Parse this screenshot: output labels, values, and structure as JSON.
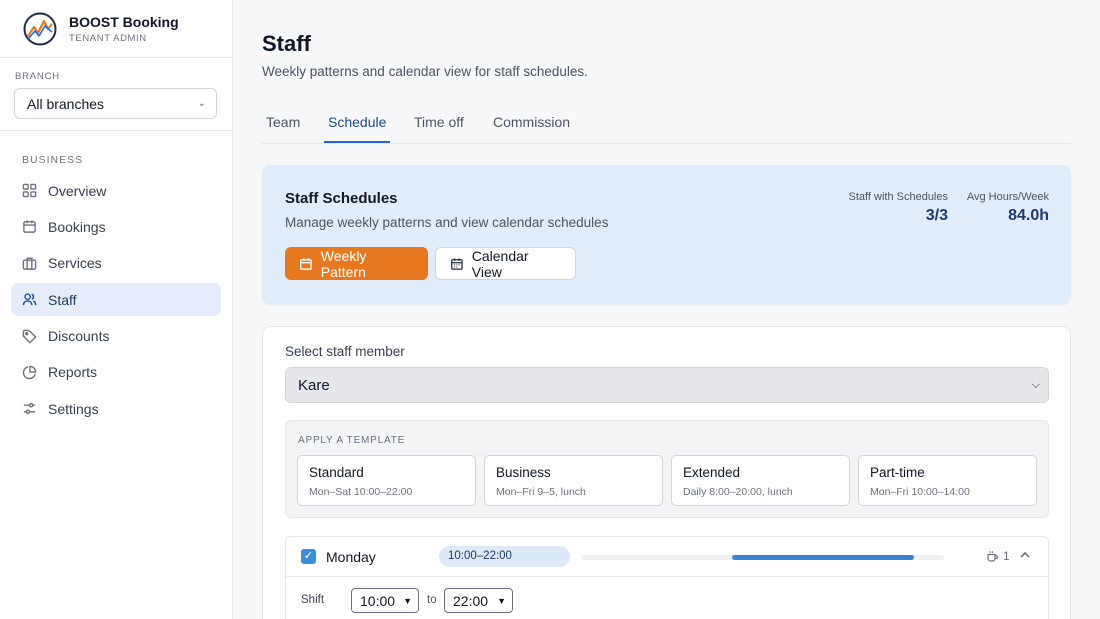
{
  "brand": {
    "name": "BOOST Booking",
    "role": "TENANT ADMIN"
  },
  "branch": {
    "label": "BRANCH",
    "selected": "All branches"
  },
  "sidebar": {
    "section": "BUSINESS",
    "items": [
      {
        "label": "Overview",
        "icon": "grid-icon"
      },
      {
        "label": "Bookings",
        "icon": "calendar-icon"
      },
      {
        "label": "Services",
        "icon": "briefcase-icon"
      },
      {
        "label": "Staff",
        "icon": "users-icon",
        "active": true
      },
      {
        "label": "Discounts",
        "icon": "tag-icon"
      },
      {
        "label": "Reports",
        "icon": "pie-chart-icon"
      },
      {
        "label": "Settings",
        "icon": "sliders-icon"
      }
    ]
  },
  "page": {
    "title": "Staff",
    "subtitle": "Weekly patterns and calendar view for staff schedules."
  },
  "tabs": [
    {
      "label": "Team"
    },
    {
      "label": "Schedule",
      "active": true
    },
    {
      "label": "Time off"
    },
    {
      "label": "Commission"
    }
  ],
  "hero": {
    "title": "Staff Schedules",
    "subtitle": "Manage weekly patterns and view calendar schedules",
    "stats": [
      {
        "label": "Staff with Schedules",
        "value": "3/3"
      },
      {
        "label": "Avg Hours/Week",
        "value": "84.0h"
      }
    ],
    "buttons": {
      "weekly": "Weekly Pattern",
      "calendar": "Calendar View"
    }
  },
  "editor": {
    "staff_label": "Select staff member",
    "staff_selected": "Kare",
    "template_label": "APPLY A TEMPLATE",
    "templates": [
      {
        "name": "Standard",
        "desc": "Mon–Sat 10:00–22:00"
      },
      {
        "name": "Business",
        "desc": "Mon–Fri 9–5, lunch"
      },
      {
        "name": "Extended",
        "desc": "Daily 8:00–20:00, lunch"
      },
      {
        "name": "Part-time",
        "desc": "Mon–Fri 10:00–14:00"
      }
    ],
    "day": {
      "name": "Monday",
      "checked": "✓",
      "range": "10:00–22:00",
      "coverage": {
        "start_fraction": 0.417,
        "end_fraction": 0.917
      },
      "breaks": "1",
      "shift_label": "Shift",
      "to_label": "to",
      "start": "10:00",
      "end": "22:00"
    }
  },
  "colors": {
    "accent": "#e8781f",
    "primary": "#2563eb",
    "hero_bg": "#e0ecf9",
    "active_nav_bg": "#e4edf9"
  }
}
